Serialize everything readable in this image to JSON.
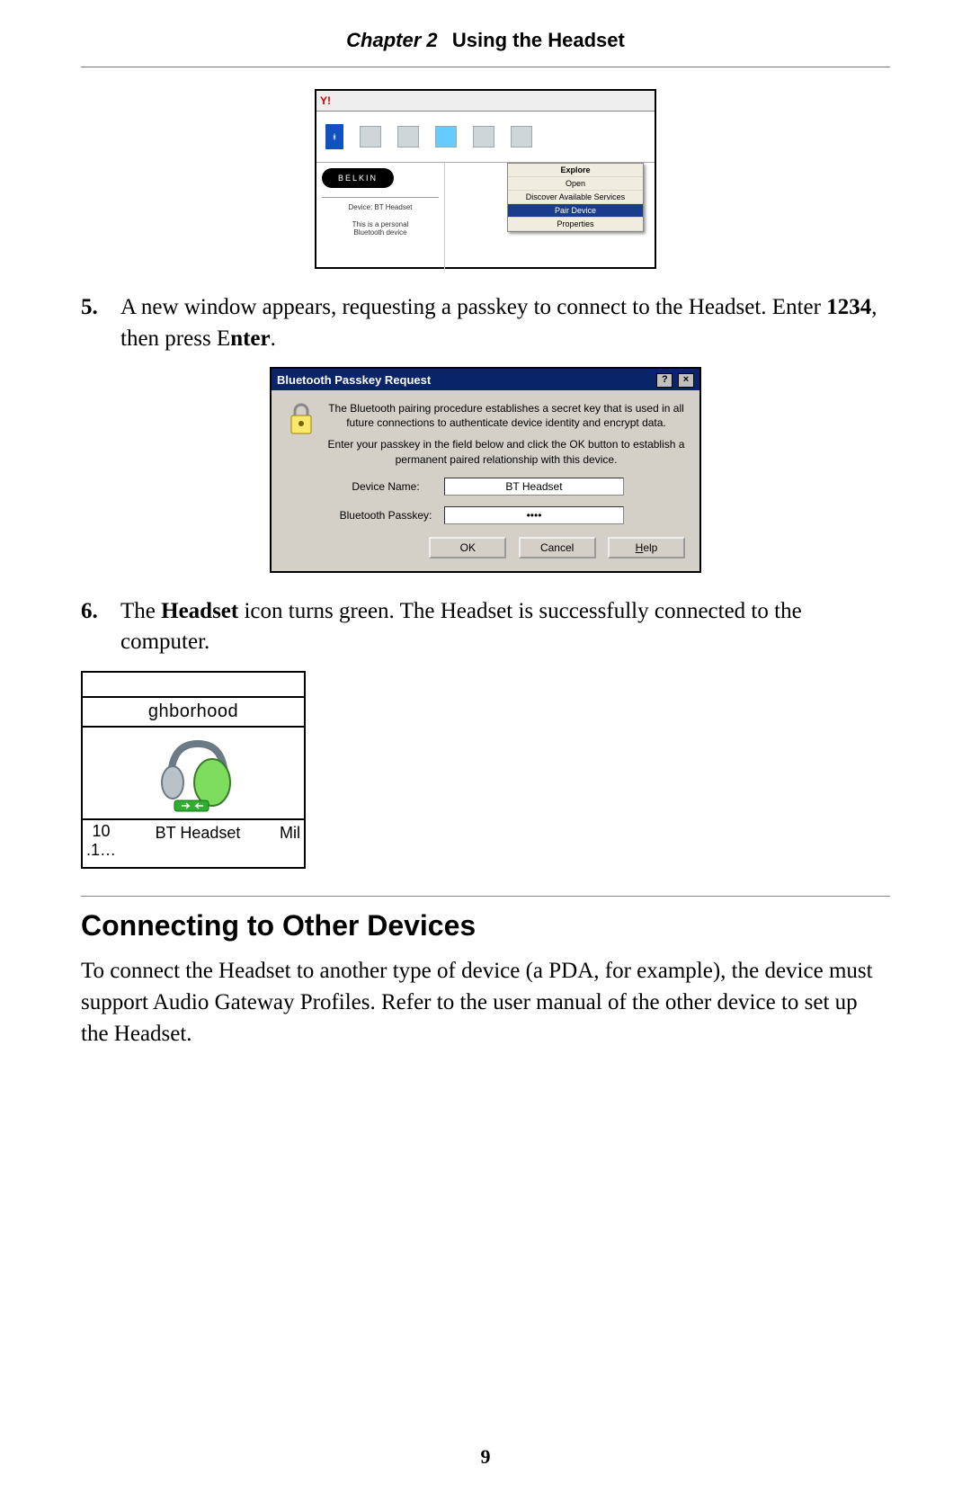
{
  "header": {
    "chapter": "Chapter 2",
    "title": "Using the Headset"
  },
  "steps": {
    "s5": {
      "num": "5.",
      "text_a": "A new window appears, requesting a passkey to connect to the Headset. Enter ",
      "code": "1234",
      "text_b": ", then press E",
      "text_c": "nter",
      "text_d": "."
    },
    "s6": {
      "num": "6.",
      "text_a": "The ",
      "bold": "Headset",
      "text_b": " icon turns green. The Headset is successfully connected to the computer."
    }
  },
  "fig1": {
    "brand": "BELKIN",
    "menu": {
      "explore": "Explore",
      "open": "Open",
      "discover": "Discover Available Services",
      "pair": "Pair Device",
      "props": "Properties"
    },
    "sidebar_line1": "Device: BT Headset",
    "sidebar_line2": "This is a personal",
    "sidebar_line3": "Bluetooth device"
  },
  "fig2": {
    "title": "Bluetooth Passkey Request",
    "p1": "The Bluetooth pairing procedure establishes a secret key that is used in all future connections to authenticate device identity and encrypt data.",
    "p2": "Enter your passkey in the field below and click the OK button to establish a permanent paired relationship with this device.",
    "device_label": "Device Name:",
    "device_value": "BT Headset",
    "passkey_label": "Bluetooth Passkey:",
    "passkey_value": "••••",
    "ok": "OK",
    "cancel": "Cancel",
    "help": "Help"
  },
  "fig3": {
    "top_text": "ghborhood",
    "left_num_top": "10",
    "left_num_bot": ".1…",
    "center": "BT Headset",
    "right": "Mil"
  },
  "section": {
    "heading": "Connecting to Other Devices",
    "para": "To connect the Headset to another type of device (a PDA, for example), the device must support Audio Gateway Profiles. Refer to the user manual of the other device to set up the Headset."
  },
  "page_number": "9"
}
